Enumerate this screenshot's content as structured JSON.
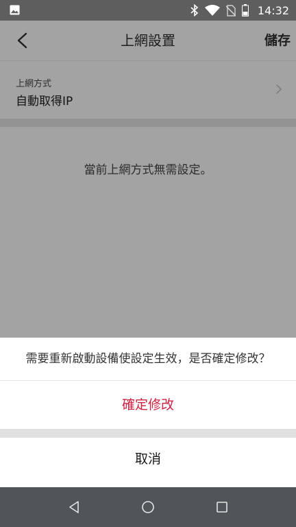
{
  "status_bar": {
    "time": "14:32",
    "icons": [
      "image-icon",
      "bluetooth-icon",
      "wifi-icon",
      "no-sim-icon",
      "battery-icon"
    ]
  },
  "header": {
    "back_icon": "chevron-left-icon",
    "title": "上網設置",
    "save_label": "儲存"
  },
  "connection": {
    "label": "上網方式",
    "value": "自動取得IP",
    "chevron_icon": "chevron-right-icon"
  },
  "info": {
    "message": "當前上網方式無需設定。"
  },
  "dialog": {
    "message": "需要重新啟動設備使設定生效，是否確定修改？",
    "confirm_label": "確定修改",
    "cancel_label": "取消"
  },
  "nav_bar": {
    "icons": [
      "nav-back-icon",
      "nav-home-icon",
      "nav-recents-icon"
    ]
  },
  "colors": {
    "accent_red": "#cf1f3f",
    "overlay_gray": "#a3a3a3",
    "status_bar": "#5e5e5e",
    "nav_bar": "#4f5559"
  }
}
